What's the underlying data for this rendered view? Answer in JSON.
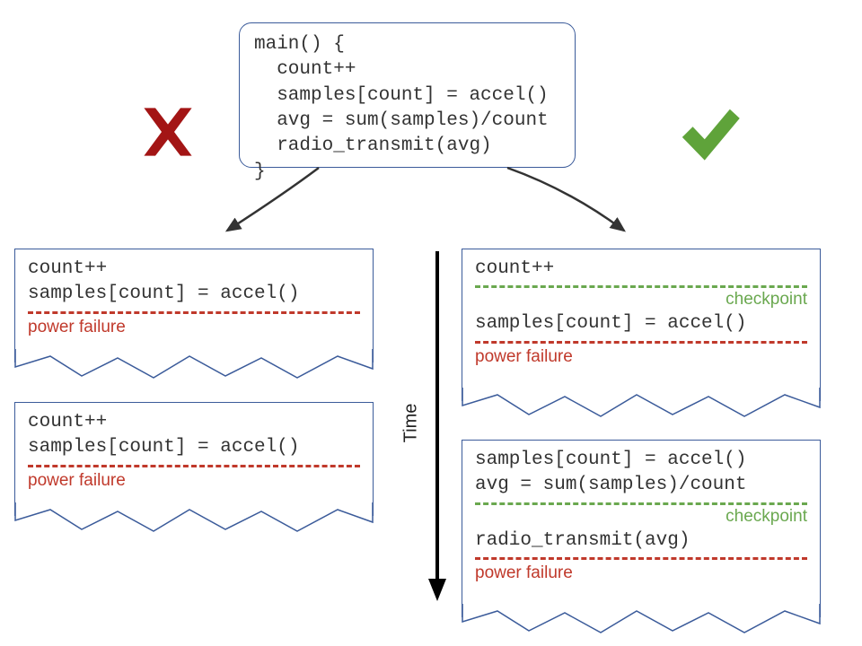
{
  "main_code": "main() {\n  count++\n  samples[count] = accel()\n  avg = sum(samples)/count\n  radio_transmit(avg)\n}",
  "left": {
    "box1": {
      "lines": "count++\nsamples[count] = accel()",
      "failure": "power failure"
    },
    "box2": {
      "lines": "count++\nsamples[count] = accel()",
      "failure": "power failure"
    }
  },
  "right": {
    "box1": {
      "line_a": "count++",
      "checkpoint": "checkpoint",
      "line_b": "samples[count] = accel()",
      "failure": "power failure"
    },
    "box2": {
      "lines_a": "samples[count] = accel()\navg = sum(samples)/count",
      "checkpoint": "checkpoint",
      "line_b": "radio_transmit(avg)",
      "failure": "power failure"
    }
  },
  "time_label": "Time",
  "colors": {
    "border": "#3b5b9a",
    "red": "#c0392b",
    "green": "#6aa84f",
    "cross": "#a31515",
    "check": "#5fa33a"
  }
}
